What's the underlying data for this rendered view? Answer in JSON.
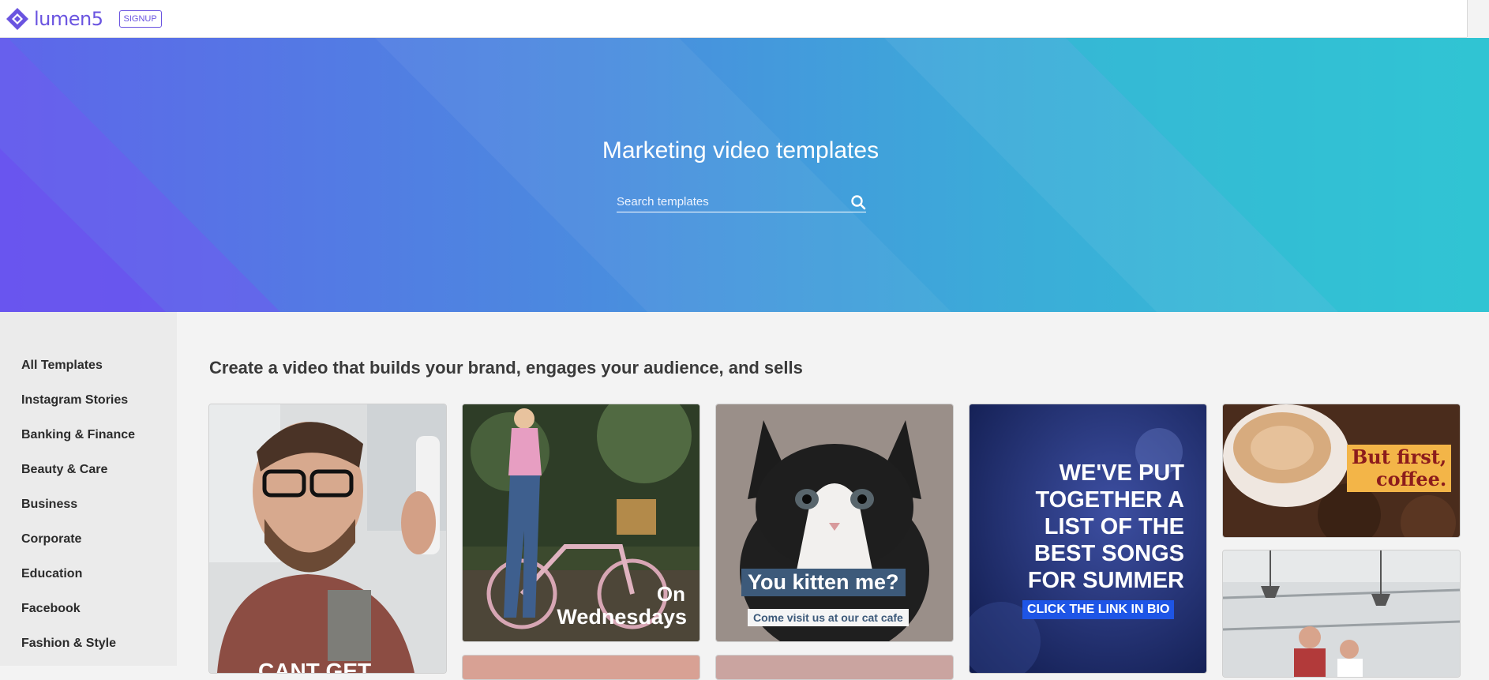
{
  "header": {
    "logo_text": "lumen5",
    "signup_label": "SIGNUP"
  },
  "hero": {
    "title": "Marketing video templates",
    "search_placeholder": "Search templates"
  },
  "sidebar": {
    "items": [
      "All Templates",
      "Instagram Stories",
      "Banking & Finance",
      "Beauty & Care",
      "Business",
      "Corporate",
      "Education",
      "Facebook",
      "Fashion & Style"
    ]
  },
  "main": {
    "heading": "Create a video that builds your brand, engages your audience, and sells",
    "cards": {
      "selfie": {
        "text": "CANT GET"
      },
      "bike": {
        "line1": "On",
        "line2": "Wednesdays"
      },
      "kitten": {
        "title": "You kitten me?",
        "sub": "Come visit us at our cat cafe"
      },
      "songs": {
        "l1": "WE'VE PUT",
        "l2": "TOGETHER A",
        "l3": "LIST OF THE",
        "l4": "BEST SONGS",
        "l5": "FOR SUMMER",
        "cta": "CLICK THE LINK IN BIO"
      },
      "coffee": {
        "l1": "But first,",
        "l2": "coffee."
      }
    }
  },
  "colors": {
    "brand": "#6a54e0",
    "hero_start": "#5e66ea",
    "hero_end": "#31c4d4"
  }
}
